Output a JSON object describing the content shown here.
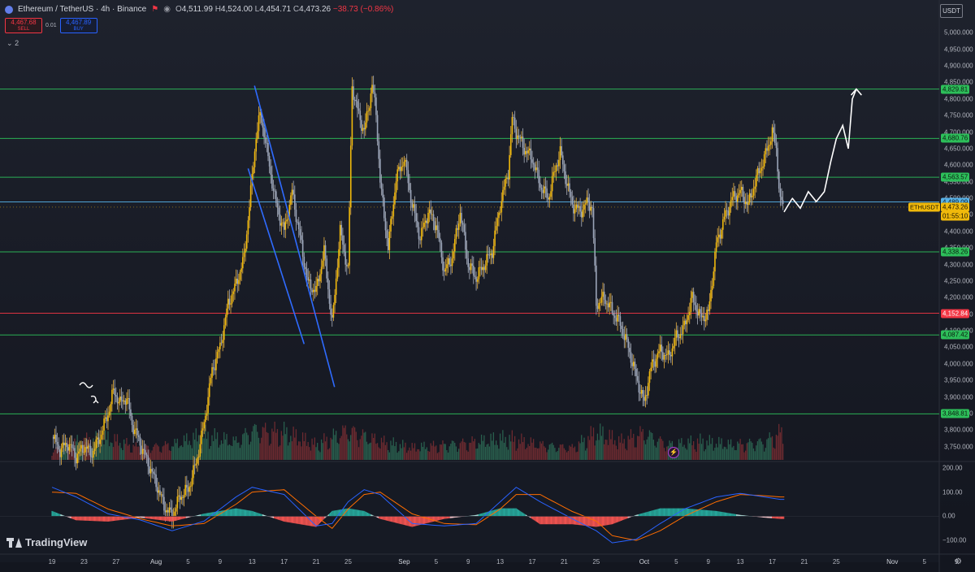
{
  "header": {
    "symbol_title": "Ethereum / TetherUS · 4h · Binance",
    "open_label": "O",
    "open": "4,511.99",
    "high_label": "H",
    "high": "4,524.00",
    "low_label": "L",
    "low": "4,454.71",
    "close_label": "C",
    "close": "4,473.26",
    "change": "−38.73 (−0.86%)"
  },
  "trade": {
    "sell_price": "4,467.68",
    "sell_label": "SELL",
    "spread": "0.01",
    "buy_price": "4,467.89",
    "buy_label": "BUY"
  },
  "indicators_toggle": "2",
  "currency": "USDT",
  "branding": "TradingView",
  "colors": {
    "bull": "#e9b341",
    "bear": "#aab0bd",
    "bull_body": "#f0b90b",
    "bear_body": "#9aa4b8",
    "support": "#2dbf5a",
    "critical": "#f23645",
    "current": "#57b2e8",
    "macd": "#2962ff",
    "signal": "#ff6d00"
  },
  "chart_data": [
    {
      "type": "line",
      "title": "Ethereum / TetherUS · 4h · Binance",
      "y_axis": {
        "min": 3710,
        "max": 5040,
        "ticks": [
          5000,
          4950,
          4900,
          4850,
          4800,
          4750,
          4700,
          4650,
          4600,
          4550,
          4500,
          4450,
          4400,
          4350,
          4300,
          4250,
          4200,
          4150,
          4100,
          4050,
          4000,
          3950,
          3900,
          3850,
          3800,
          3750
        ]
      },
      "x_axis": {
        "ticks": [
          {
            "label": "19",
            "day": 19
          },
          {
            "label": "23",
            "day": 23
          },
          {
            "label": "27",
            "day": 27
          },
          {
            "label": "Aug",
            "day": 32,
            "month": true
          },
          {
            "label": "5",
            "day": 36
          },
          {
            "label": "9",
            "day": 40
          },
          {
            "label": "13",
            "day": 44
          },
          {
            "label": "17",
            "day": 48
          },
          {
            "label": "21",
            "day": 52
          },
          {
            "label": "25",
            "day": 56
          },
          {
            "label": "Sep",
            "day": 63,
            "month": true
          },
          {
            "label": "5",
            "day": 67
          },
          {
            "label": "9",
            "day": 71
          },
          {
            "label": "13",
            "day": 75
          },
          {
            "label": "17",
            "day": 79
          },
          {
            "label": "21",
            "day": 83
          },
          {
            "label": "25",
            "day": 87
          },
          {
            "label": "Oct",
            "day": 93,
            "month": true
          },
          {
            "label": "5",
            "day": 97
          },
          {
            "label": "9",
            "day": 101
          },
          {
            "label": "13",
            "day": 105
          },
          {
            "label": "17",
            "day": 109
          },
          {
            "label": "21",
            "day": 113
          },
          {
            "label": "25",
            "day": 117
          },
          {
            "label": "Nov",
            "day": 124,
            "month": true
          },
          {
            "label": "5",
            "day": 128
          },
          {
            "label": "9",
            "day": 132
          }
        ]
      },
      "horizontal_levels": [
        {
          "price": 4829.81,
          "label": "4,829.81",
          "kind": "green"
        },
        {
          "price": 4680.76,
          "label": "4,680.76",
          "kind": "green"
        },
        {
          "price": 4563.57,
          "label": "4,563.57",
          "kind": "green"
        },
        {
          "price": 4489.09,
          "label": "4,489.09",
          "kind": "blue"
        },
        {
          "price": 4338.26,
          "label": "4,338.26",
          "kind": "green"
        },
        {
          "price": 4152.84,
          "label": "4,152.84",
          "kind": "red"
        },
        {
          "price": 4087.42,
          "label": "4,087.42",
          "kind": "green"
        },
        {
          "price": 3848.81,
          "label": "3,848.81",
          "kind": "green"
        }
      ],
      "last_price": {
        "price": 4473.26,
        "label": "4,473.26",
        "countdown": "01:55:10",
        "symbol": "ETHUSDT"
      },
      "price_path": [
        [
          19,
          3780
        ],
        [
          20,
          3740
        ],
        [
          21,
          3760
        ],
        [
          22,
          3720
        ],
        [
          23,
          3750
        ],
        [
          24,
          3730
        ],
        [
          25,
          3780
        ],
        [
          26,
          3850
        ],
        [
          26.7,
          3920
        ],
        [
          27.5,
          3880
        ],
        [
          28.3,
          3900
        ],
        [
          29,
          3820
        ],
        [
          30,
          3760
        ],
        [
          31,
          3700
        ],
        [
          32,
          3640
        ],
        [
          33,
          3570
        ],
        [
          34,
          3540
        ],
        [
          35,
          3600
        ],
        [
          36,
          3620
        ],
        [
          37,
          3700
        ],
        [
          38,
          3820
        ],
        [
          39,
          3980
        ],
        [
          40,
          4050
        ],
        [
          41,
          4180
        ],
        [
          42,
          4240
        ],
        [
          43,
          4320
        ],
        [
          44,
          4560
        ],
        [
          44.5,
          4690
        ],
        [
          45,
          4750
        ],
        [
          45.5,
          4700
        ],
        [
          46,
          4620
        ],
        [
          47,
          4480
        ],
        [
          48,
          4400
        ],
        [
          49,
          4520
        ],
        [
          50,
          4380
        ],
        [
          51,
          4240
        ],
        [
          52,
          4220
        ],
        [
          53,
          4340
        ],
        [
          54,
          4120
        ],
        [
          55,
          4400
        ],
        [
          56,
          4280
        ],
        [
          56.5,
          4840
        ],
        [
          57,
          4780
        ],
        [
          58,
          4700
        ],
        [
          59,
          4840
        ],
        [
          59.5,
          4760
        ],
        [
          60,
          4550
        ],
        [
          61,
          4350
        ],
        [
          62,
          4560
        ],
        [
          63,
          4620
        ],
        [
          64,
          4480
        ],
        [
          65,
          4380
        ],
        [
          66,
          4460
        ],
        [
          67,
          4420
        ],
        [
          68,
          4280
        ],
        [
          69,
          4320
        ],
        [
          70,
          4460
        ],
        [
          71,
          4300
        ],
        [
          72,
          4260
        ],
        [
          73,
          4300
        ],
        [
          74,
          4340
        ],
        [
          75,
          4480
        ],
        [
          76,
          4580
        ],
        [
          76.5,
          4740
        ],
        [
          77,
          4700
        ],
        [
          78,
          4650
        ],
        [
          79,
          4620
        ],
        [
          80,
          4540
        ],
        [
          81,
          4500
        ],
        [
          82,
          4600
        ],
        [
          82.5,
          4640
        ],
        [
          83,
          4580
        ],
        [
          84,
          4480
        ],
        [
          85,
          4460
        ],
        [
          86,
          4490
        ],
        [
          86.5,
          4470
        ],
        [
          87,
          4180
        ],
        [
          88,
          4200
        ],
        [
          89,
          4160
        ],
        [
          90,
          4120
        ],
        [
          91,
          4050
        ],
        [
          92,
          3960
        ],
        [
          93,
          3880
        ],
        [
          93.5,
          3950
        ],
        [
          94,
          4000
        ],
        [
          95,
          4040
        ],
        [
          96,
          4020
        ],
        [
          97,
          4080
        ],
        [
          98,
          4110
        ],
        [
          99,
          4200
        ],
        [
          100,
          4140
        ],
        [
          101,
          4150
        ],
        [
          102,
          4360
        ],
        [
          103,
          4440
        ],
        [
          104,
          4500
        ],
        [
          105,
          4520
        ],
        [
          106,
          4480
        ],
        [
          107,
          4560
        ],
        [
          108,
          4620
        ],
        [
          109,
          4700
        ],
        [
          109.5,
          4650
        ],
        [
          110,
          4490
        ],
        [
          110.5,
          4473
        ]
      ],
      "volume_path": [
        [
          19,
          0.3
        ],
        [
          22,
          0.6
        ],
        [
          26,
          0.7
        ],
        [
          30,
          0.4
        ],
        [
          34,
          0.5
        ],
        [
          38,
          0.8
        ],
        [
          42,
          0.6
        ],
        [
          44,
          1.0
        ],
        [
          48,
          0.9
        ],
        [
          52,
          0.5
        ],
        [
          56,
          1.0
        ],
        [
          60,
          0.6
        ],
        [
          64,
          0.4
        ],
        [
          68,
          0.5
        ],
        [
          72,
          0.6
        ],
        [
          76,
          0.7
        ],
        [
          80,
          0.5
        ],
        [
          84,
          0.4
        ],
        [
          87,
          0.9
        ],
        [
          90,
          0.6
        ],
        [
          93,
          0.9
        ],
        [
          96,
          0.5
        ],
        [
          100,
          0.6
        ],
        [
          104,
          0.5
        ],
        [
          108,
          0.6
        ],
        [
          110,
          0.9
        ]
      ],
      "hand_drawn_projection": [
        [
          110.5,
          4460
        ],
        [
          111.5,
          4500
        ],
        [
          112.5,
          4470
        ],
        [
          113.5,
          4520
        ],
        [
          114.5,
          4490
        ],
        [
          115.5,
          4520
        ],
        [
          116.3,
          4610
        ],
        [
          117,
          4680
        ],
        [
          117.8,
          4720
        ],
        [
          118.5,
          4650
        ],
        [
          119,
          4800
        ],
        [
          119.5,
          4830
        ]
      ],
      "hand_drawn_channel": [
        {
          "from": [
            44.3,
            4840
          ],
          "to": [
            54.3,
            3930
          ]
        },
        {
          "from": [
            43.5,
            4590
          ],
          "to": [
            50.5,
            4060
          ]
        }
      ]
    },
    {
      "type": "line",
      "title": "",
      "y_axis": {
        "min": -150,
        "max": 220,
        "ticks": [
          200.0,
          100.0,
          0.0,
          -100.0
        ]
      },
      "y_axis_labels": [
        "200.00",
        "100.00",
        "0.00",
        "−100.00"
      ],
      "series": [
        {
          "values": [
            [
              19,
              120
            ],
            [
              22,
              80
            ],
            [
              26,
              10
            ],
            [
              30,
              -15
            ],
            [
              34,
              -60
            ],
            [
              38,
              -20
            ],
            [
              42,
              80
            ],
            [
              44,
              120
            ],
            [
              48,
              90
            ],
            [
              52,
              -40
            ],
            [
              54,
              -30
            ],
            [
              56,
              60
            ],
            [
              58,
              110
            ],
            [
              60,
              90
            ],
            [
              64,
              -30
            ],
            [
              68,
              -40
            ],
            [
              72,
              -30
            ],
            [
              75,
              60
            ],
            [
              77,
              120
            ],
            [
              80,
              60
            ],
            [
              84,
              -10
            ],
            [
              87,
              -60
            ],
            [
              89,
              -110
            ],
            [
              92,
              -95
            ],
            [
              95,
              -30
            ],
            [
              98,
              30
            ],
            [
              102,
              80
            ],
            [
              105,
              95
            ],
            [
              108,
              80
            ],
            [
              110,
              70
            ]
          ]
        },
        {
          "values": [
            [
              19,
              100
            ],
            [
              22,
              95
            ],
            [
              26,
              30
            ],
            [
              30,
              -10
            ],
            [
              34,
              -40
            ],
            [
              38,
              -30
            ],
            [
              42,
              50
            ],
            [
              44,
              100
            ],
            [
              48,
              110
            ],
            [
              52,
              0
            ],
            [
              54,
              -50
            ],
            [
              56,
              30
            ],
            [
              58,
              90
            ],
            [
              60,
              100
            ],
            [
              64,
              10
            ],
            [
              68,
              -30
            ],
            [
              72,
              -35
            ],
            [
              75,
              30
            ],
            [
              77,
              90
            ],
            [
              80,
              90
            ],
            [
              84,
              20
            ],
            [
              87,
              -20
            ],
            [
              89,
              -80
            ],
            [
              92,
              -100
            ],
            [
              95,
              -60
            ],
            [
              98,
              0
            ],
            [
              102,
              60
            ],
            [
              105,
              90
            ],
            [
              108,
              85
            ],
            [
              110,
              80
            ]
          ]
        }
      ]
    }
  ]
}
